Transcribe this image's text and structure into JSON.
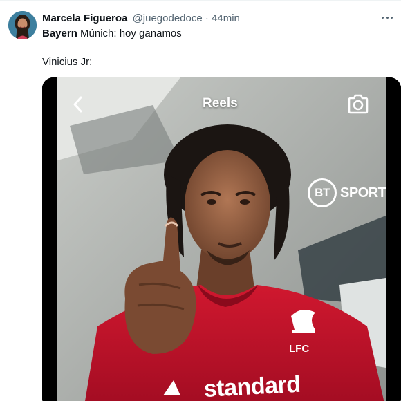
{
  "author": {
    "name": "Marcela Figueroa",
    "handle": "@juegodedoce",
    "separator": "·",
    "time": "44min"
  },
  "tweet": {
    "line1_bold": "Bayern",
    "line1_rest": " Múnich: hoy ganamos",
    "line2": "Vinicius Jr:"
  },
  "media": {
    "screen_title": "Reels",
    "back_icon": "chevron-left-icon",
    "camera_icon": "camera-icon",
    "channel_logo_short": "BT",
    "channel_logo_word": "SPORT",
    "crest_text": "LFC",
    "shirt_sponsor": "standard"
  },
  "icons": {
    "more": "more-horizontal-icon"
  },
  "colors": {
    "text_primary": "#0f1419",
    "text_secondary": "#536471",
    "jersey_red": "#c8102e"
  }
}
